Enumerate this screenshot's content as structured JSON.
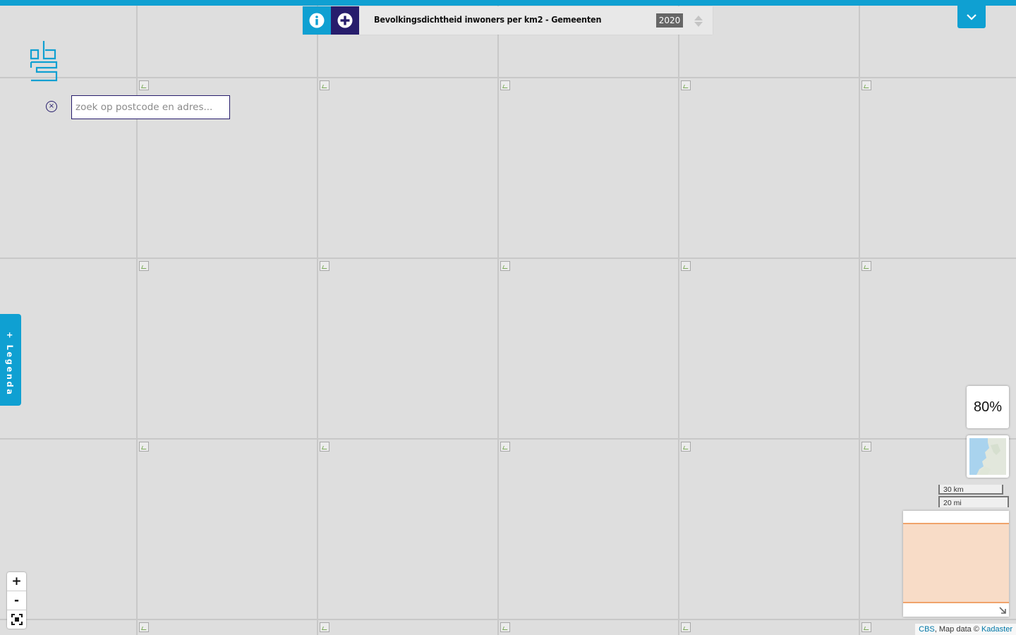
{
  "header": {
    "title": "Bevolkingsdichtheid inwoners per km2 - Gemeenten",
    "year": "2020",
    "info_icon": "info-icon",
    "add_icon": "plus-circle-icon",
    "collapse_icon": "chevron-down-icon"
  },
  "search": {
    "placeholder": "zoek op postcode en adres...",
    "value": "",
    "clear_label": "×"
  },
  "legend": {
    "label": "+ Legenda"
  },
  "controls": {
    "opacity": "80%",
    "zoom_in": "+",
    "zoom_out": "-",
    "fullscreen_icon": "fullscreen-icon"
  },
  "scale": {
    "km": "30 km",
    "mi": "20 mi"
  },
  "attribution": {
    "cbs": "CBS",
    "middle": ", Map data © ",
    "kadaster": "Kadaster"
  },
  "colors": {
    "accent": "#0fa0d2",
    "dark": "#271d6c",
    "overview_extent": "#f8dcc7"
  }
}
